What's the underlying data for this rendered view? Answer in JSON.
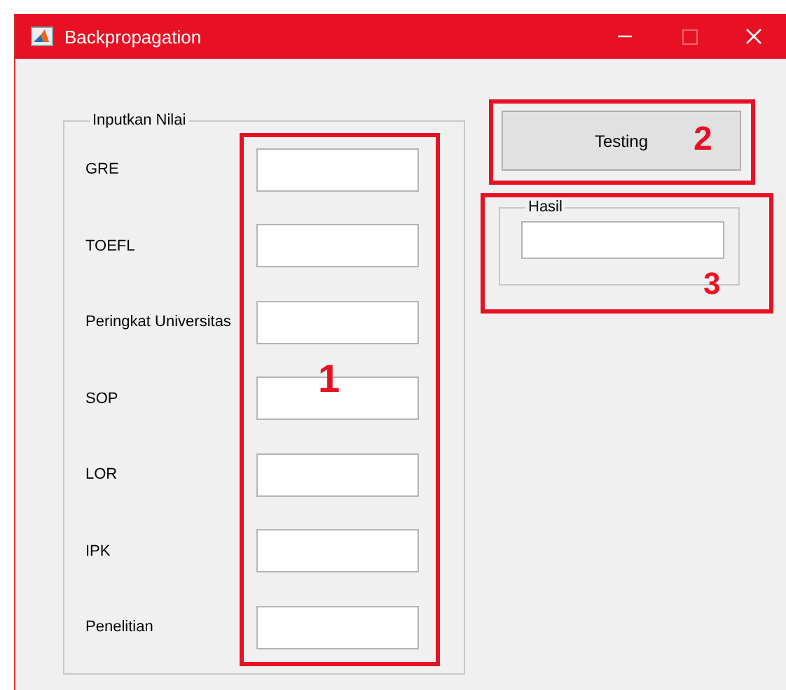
{
  "window": {
    "title": "Backpropagation",
    "controls": [
      {
        "kind": "minimize",
        "disabled": false
      },
      {
        "kind": "maximize",
        "disabled": true
      },
      {
        "kind": "close",
        "disabled": false
      }
    ]
  },
  "input_panel": {
    "legend": "Inputkan Nilai",
    "fields": [
      {
        "label": "GRE"
      },
      {
        "label": "TOEFL"
      },
      {
        "label": "Peringkat Universitas"
      },
      {
        "label": "SOP"
      },
      {
        "label": "LOR"
      },
      {
        "label": "IPK"
      },
      {
        "label": "Penelitian"
      }
    ]
  },
  "testing_button": {
    "label": "Testing"
  },
  "result_panel": {
    "legend": "Hasil"
  },
  "annotations": [
    {
      "number": "1",
      "kind": "fields"
    },
    {
      "number": "2",
      "kind": "button"
    },
    {
      "number": "3",
      "kind": "result"
    }
  ]
}
